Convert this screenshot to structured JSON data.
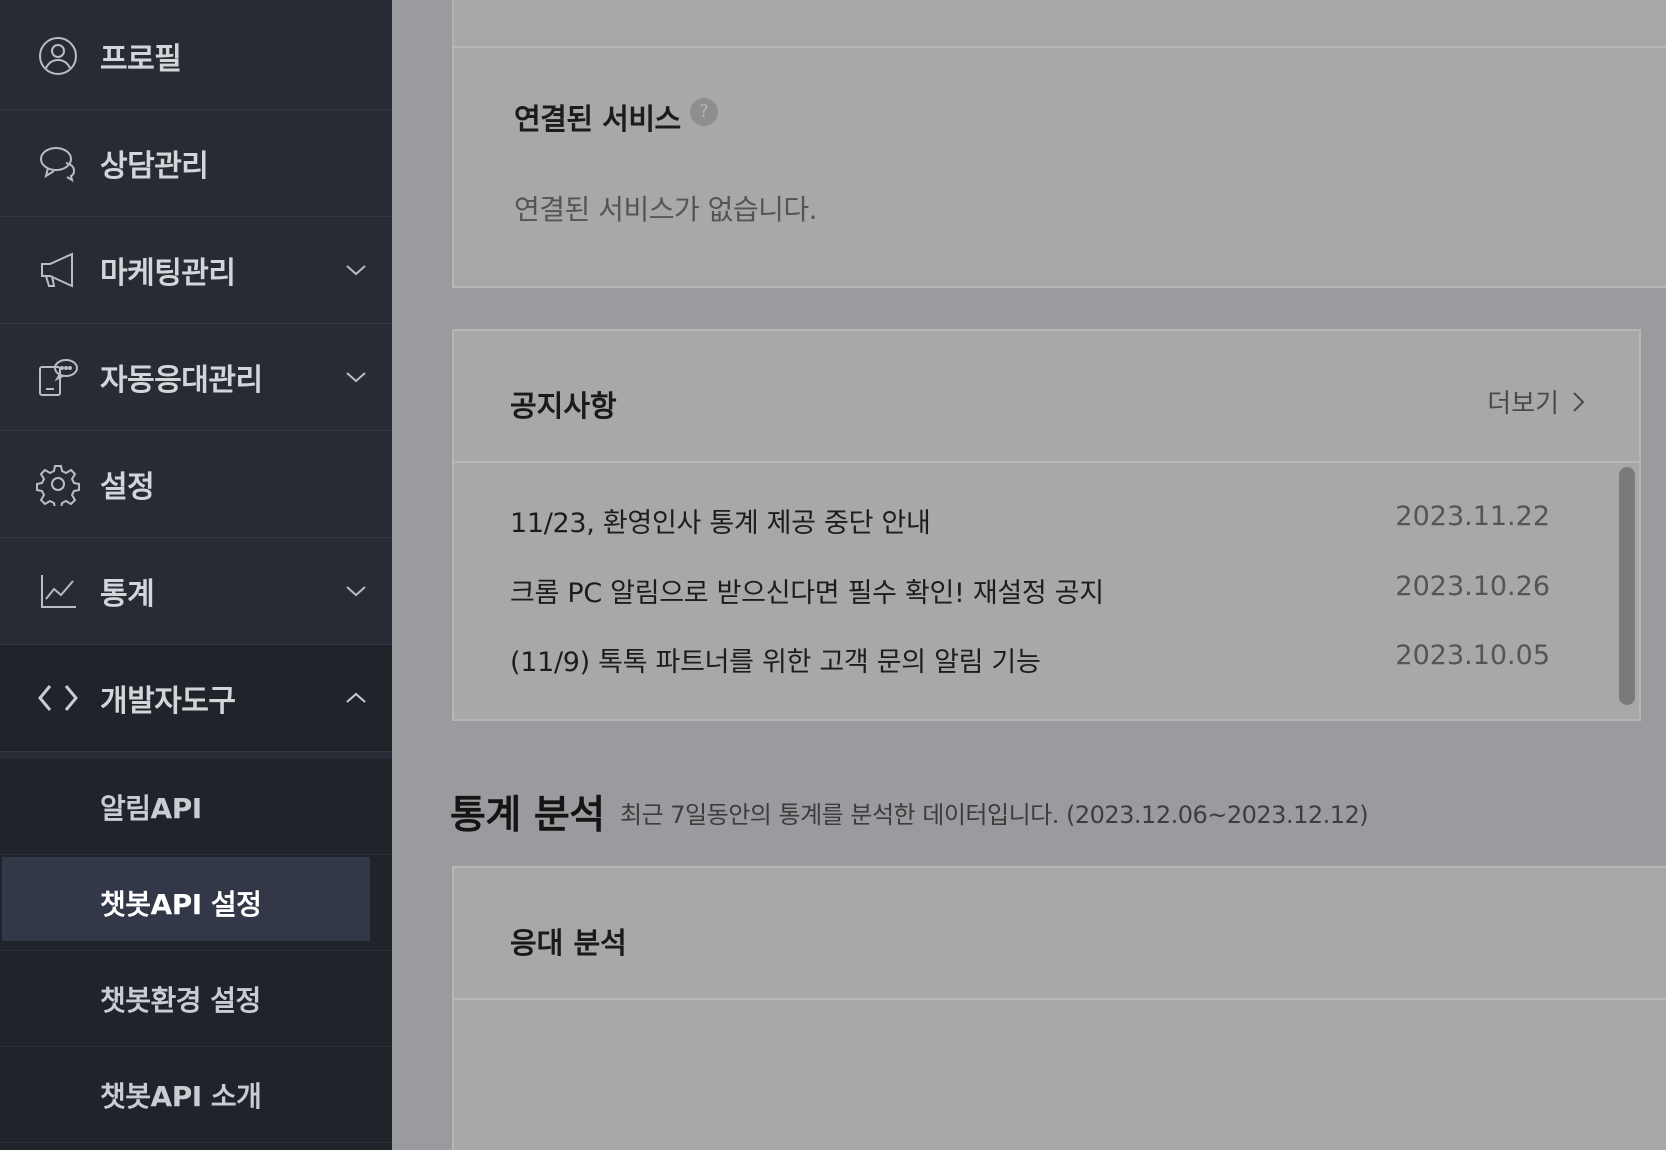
{
  "sidebar": {
    "items": [
      {
        "label": "프로필",
        "icon": "profile-icon",
        "has_chevron": false
      },
      {
        "label": "상담관리",
        "icon": "chat-icon",
        "has_chevron": false
      },
      {
        "label": "마케팅관리",
        "icon": "megaphone-icon",
        "has_chevron": true,
        "expanded": false
      },
      {
        "label": "자동응대관리",
        "icon": "auto-reply-icon",
        "has_chevron": true,
        "expanded": false
      },
      {
        "label": "설정",
        "icon": "gear-icon",
        "has_chevron": false
      },
      {
        "label": "통계",
        "icon": "chart-icon",
        "has_chevron": true,
        "expanded": false
      },
      {
        "label": "개발자도구",
        "icon": "code-icon",
        "has_chevron": true,
        "expanded": true
      }
    ],
    "submenu": [
      {
        "label": "알림API",
        "active": false
      },
      {
        "label": "챗봇API 설정",
        "active": true
      },
      {
        "label": "챗봇환경 설정",
        "active": false
      },
      {
        "label": "챗봇API 소개",
        "active": false
      }
    ]
  },
  "linked_services": {
    "title": "연결된 서비스",
    "help": "?",
    "empty_text": "연결된 서비스가 없습니다."
  },
  "notices": {
    "title": "공지사항",
    "more_label": "더보기",
    "items": [
      {
        "title": "11/23, 환영인사 통계 제공 중단 안내",
        "date": "2023.11.22"
      },
      {
        "title": "크롬 PC 알림으로 받으신다면 필수 확인! 재설정 공지",
        "date": "2023.10.26"
      },
      {
        "title": "(11/9) 톡톡 파트너를 위한 고객 문의 알림 기능",
        "date": "2023.10.05"
      }
    ]
  },
  "stats": {
    "title": "통계 분석",
    "subtitle": "최근 7일동안의 통계를 분석한 데이터입니다. (2023.12.06~2023.12.12)",
    "analysis_title": "응대 분석"
  },
  "colors": {
    "sidebar_bg": "#272b33",
    "submenu_bg": "#1f232a",
    "active_bg": "#323847",
    "main_bg": "#9a9b9e",
    "card_bg": "#a8a8a8"
  }
}
